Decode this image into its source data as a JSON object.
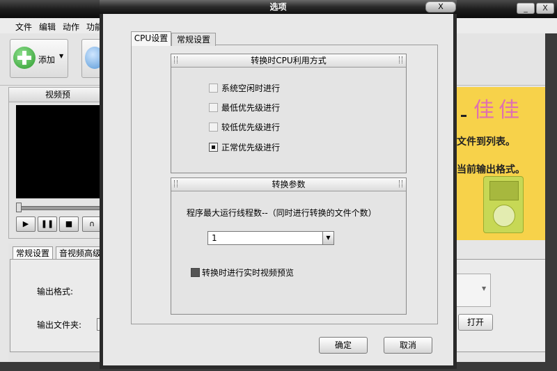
{
  "main": {
    "menu": [
      "文件",
      "编辑",
      "动作",
      "功能"
    ],
    "toolbar": {
      "add_label": "添加"
    },
    "preview": {
      "title": "视频预"
    },
    "settings": {
      "tabs": [
        "常规设置",
        "音视频高级"
      ],
      "output_format_label": "输出格式:",
      "output_folder_label": "输出文件夹:"
    },
    "ad": {
      "deco": "佳佳",
      "line1": "文件到列表。",
      "line2": "当前输出格式。"
    },
    "open_button": "打开",
    "window_controls": {
      "minimize": "_",
      "close": "X"
    }
  },
  "dialog": {
    "title": "选项",
    "close_label": "X",
    "tabs": [
      "CPU设置",
      "常规设置"
    ],
    "cpu_group": {
      "title": "转换时CPU利用方式",
      "options": [
        {
          "label": "系统空闲时进行",
          "checked": false
        },
        {
          "label": "最低优先级进行",
          "checked": false
        },
        {
          "label": "较低优先级进行",
          "checked": false
        },
        {
          "label": "正常优先级进行",
          "checked": true
        }
      ]
    },
    "param_group": {
      "title": "转换参数",
      "thread_label": "程序最大运行线程数--（同时进行转换的文件个数）",
      "thread_value": "1",
      "preview_checkbox": "转换时进行实时视频预览",
      "preview_checked": true
    },
    "ok_label": "确定",
    "cancel_label": "取消"
  }
}
